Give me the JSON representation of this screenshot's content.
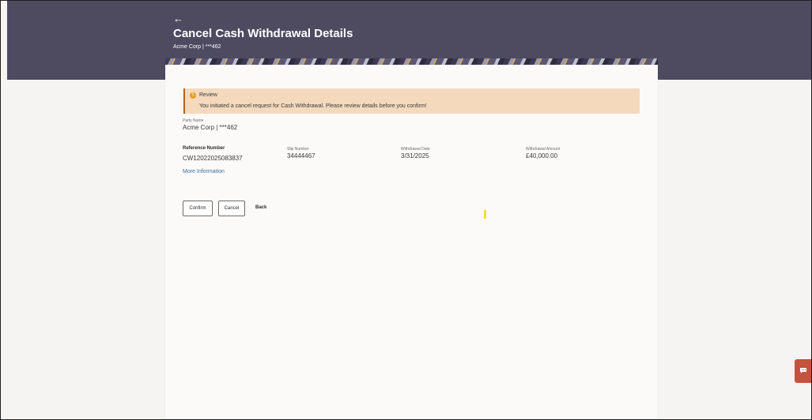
{
  "header": {
    "back_icon": "←",
    "title": "Cancel Cash Withdrawal Details",
    "subtitle": "Acme Corp | ***462"
  },
  "review": {
    "icon": "!",
    "title": "Review",
    "message": "You initiated a cancel request for Cash Withdrawal. Please review details before you confirm!"
  },
  "details": {
    "party_name_label": "Party Name",
    "party_name_value": "Acme Corp | ***462",
    "reference_label": "Reference Number",
    "reference_value": "CW12022025083837",
    "slip_label": "Slip Number",
    "slip_value": "34444467",
    "date_label": "Withdrawal Date",
    "date_value": "3/31/2025",
    "amount_label": "Withdrawal Amount",
    "amount_value": "£40,000.00",
    "more_info": "More Information"
  },
  "actions": {
    "confirm": "Confirm",
    "cancel": "Cancel",
    "back": "Back"
  },
  "colors": {
    "header": "#4e4b61",
    "banner": "#f4d9bd",
    "banner_border": "#b3621b",
    "link": "#3b6ea5",
    "chat": "#c4533a"
  },
  "icons": {
    "back": "back-arrow-icon",
    "warning": "warning-icon",
    "chat": "chat-icon"
  }
}
